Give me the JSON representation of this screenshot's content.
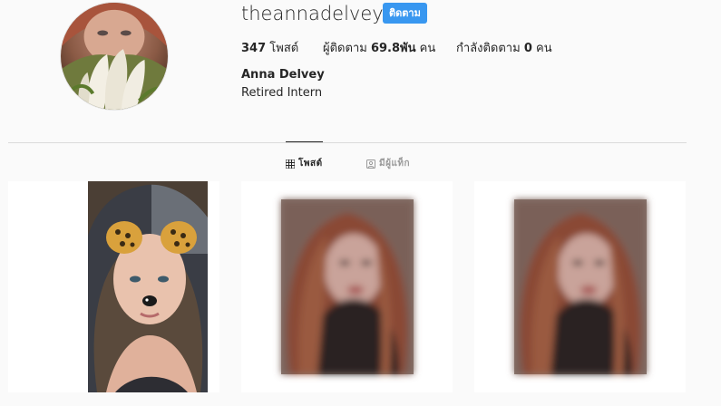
{
  "profile": {
    "username": "theannadelvey",
    "follow_label": "ติดตาม",
    "full_name": "Anna Delvey",
    "bio": "Retired Intern"
  },
  "stats": {
    "posts_count": "347",
    "posts_label": "โพสต์",
    "followers_prefix": "ผู้ติดตาม",
    "followers_count": "69.8พัน",
    "followers_suffix": "คน",
    "following_prefix": "กำลังติดตาม",
    "following_count": "0",
    "following_suffix": "คน"
  },
  "tabs": [
    {
      "label": "โพสต์",
      "icon": "grid-icon",
      "active": true
    },
    {
      "label": "มีผู้แท็ก",
      "icon": "tagged-icon",
      "active": false
    }
  ],
  "colors": {
    "accent": "#3897f0",
    "background": "#fafafa",
    "divider": "#dbdbdb"
  }
}
